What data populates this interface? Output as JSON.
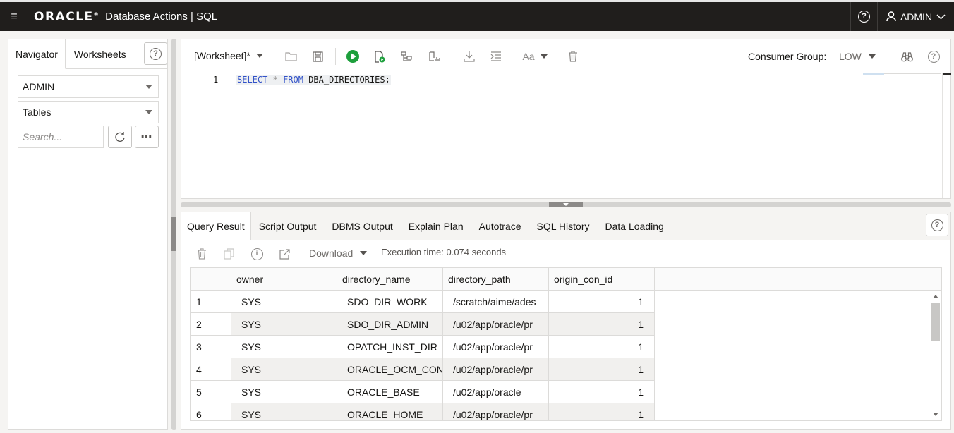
{
  "topbar": {
    "logo": "ORACLE",
    "app_title": "Database Actions",
    "separator": "|",
    "page": "SQL",
    "user": "ADMIN"
  },
  "navigator": {
    "tabs": [
      "Navigator",
      "Worksheets"
    ],
    "schema": "ADMIN",
    "object_type": "Tables",
    "search_placeholder": "Search..."
  },
  "editor": {
    "worksheet_label": "[Worksheet]*",
    "consumer_group_label": "Consumer Group:",
    "consumer_group_value": "LOW",
    "line_number": "1",
    "sql": {
      "select": "SELECT",
      "star": "*",
      "from": "FROM",
      "table": "DBA_DIRECTORIES;"
    }
  },
  "results": {
    "tabs": [
      "Query Result",
      "Script Output",
      "DBMS Output",
      "Explain Plan",
      "Autotrace",
      "SQL History",
      "Data Loading"
    ],
    "download_label": "Download",
    "execution_time": "Execution time: 0.074 seconds",
    "columns": [
      "owner",
      "directory_name",
      "directory_path",
      "origin_con_id"
    ],
    "rows": [
      {
        "n": "1",
        "owner": "SYS",
        "directory_name": "SDO_DIR_WORK",
        "directory_path": "/scratch/aime/ades",
        "origin_con_id": "1"
      },
      {
        "n": "2",
        "owner": "SYS",
        "directory_name": "SDO_DIR_ADMIN",
        "directory_path": "/u02/app/oracle/pr",
        "origin_con_id": "1"
      },
      {
        "n": "3",
        "owner": "SYS",
        "directory_name": "OPATCH_INST_DIR",
        "directory_path": "/u02/app/oracle/pr",
        "origin_con_id": "1"
      },
      {
        "n": "4",
        "owner": "SYS",
        "directory_name": "ORACLE_OCM_CON",
        "directory_path": "/u02/app/oracle/pr",
        "origin_con_id": "1"
      },
      {
        "n": "5",
        "owner": "SYS",
        "directory_name": "ORACLE_BASE",
        "directory_path": "/u02/app/oracle",
        "origin_con_id": "1"
      },
      {
        "n": "6",
        "owner": "SYS",
        "directory_name": "ORACLE_HOME",
        "directory_path": "/u02/app/oracle/pr",
        "origin_con_id": "1"
      }
    ]
  },
  "colors": {
    "topbar_bg": "#201e1c",
    "run_green": "#1d9f3c",
    "keyword_blue": "#3252c8"
  }
}
